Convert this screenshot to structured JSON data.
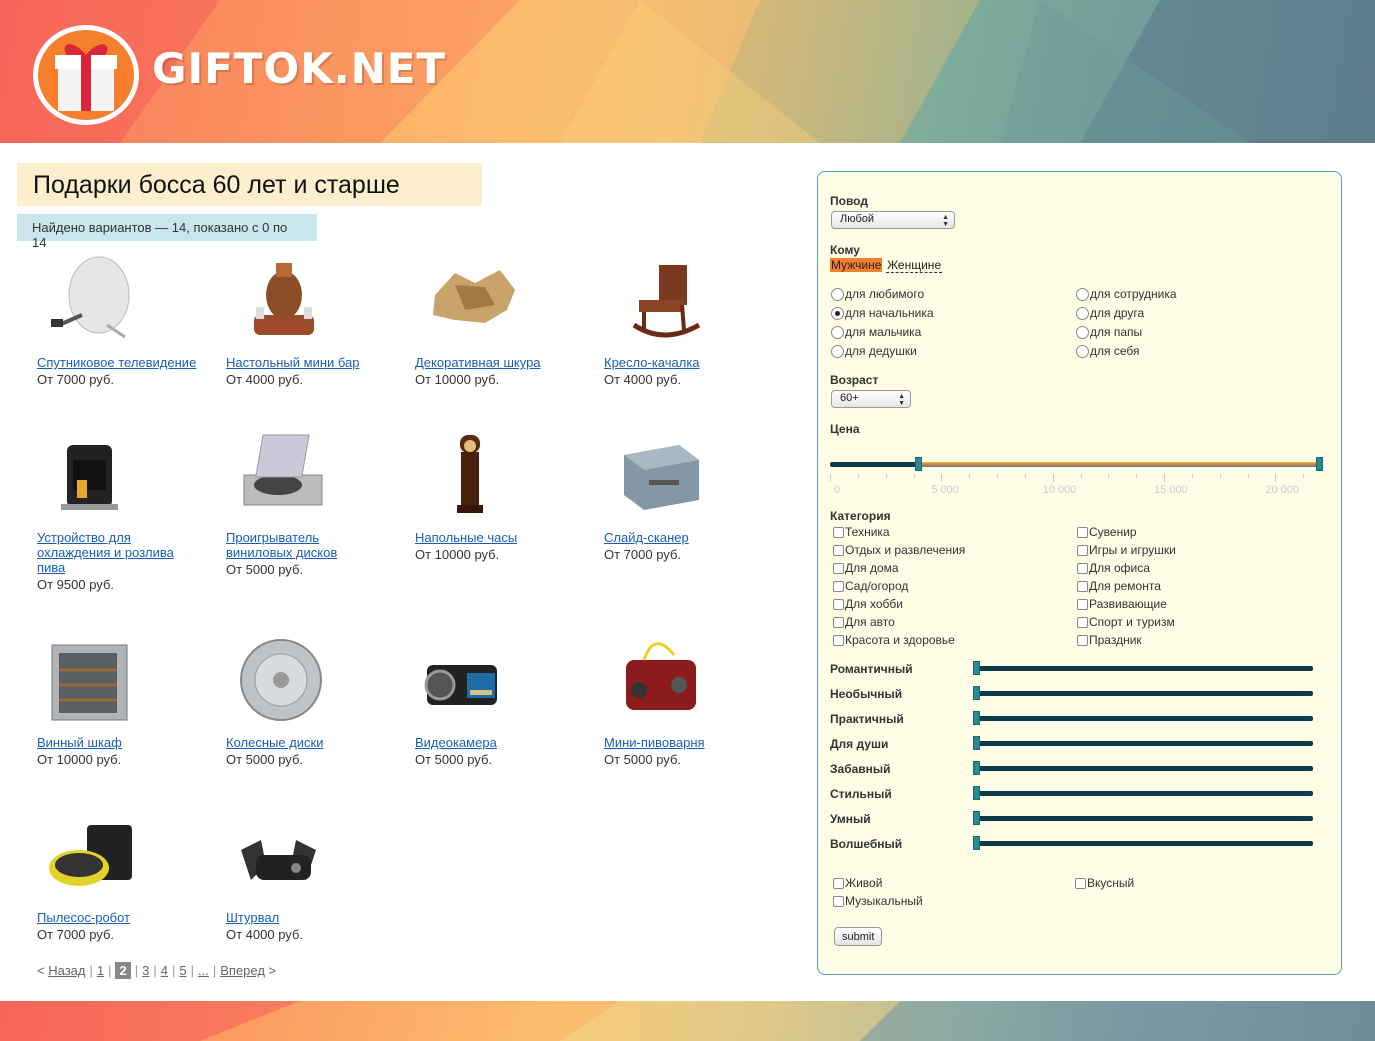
{
  "brand": "GIFTOK.NET",
  "page_title": "Подарки босса 60 лет и старше",
  "found_text": "Найдено вариантов — 14, показано с 0 по 14",
  "products": [
    {
      "name": "Спутниковое телевидение",
      "price": "От 7000 руб."
    },
    {
      "name": "Настольный мини бар",
      "price": "От 4000 руб."
    },
    {
      "name": "Декоративная шкура",
      "price": "От 10000 руб."
    },
    {
      "name": "Кресло-качалка",
      "price": "От 4000 руб."
    },
    {
      "name": "Устройство для охлаждения и розлива пива",
      "price": "От 9500 руб."
    },
    {
      "name": "Проигрыватель виниловых дисков",
      "price": "От 5000 руб."
    },
    {
      "name": "Напольные часы",
      "price": "От 10000 руб."
    },
    {
      "name": "Слайд-сканер",
      "price": "От 7000 руб."
    },
    {
      "name": "Винный шкаф",
      "price": "От 10000 руб."
    },
    {
      "name": "Колесные диски",
      "price": "От 5000 руб."
    },
    {
      "name": "Видеокамера",
      "price": "От 5000 руб."
    },
    {
      "name": "Мини-пивоварня",
      "price": "От 5000 руб."
    },
    {
      "name": "Пылесос-робот",
      "price": "От 7000 руб."
    },
    {
      "name": "Штурвал",
      "price": "От 4000 руб."
    }
  ],
  "pager": {
    "prev": "Назад",
    "next": "Вперед",
    "pages": [
      "1",
      "2",
      "3",
      "4",
      "5",
      "..."
    ],
    "current": "2"
  },
  "filters": {
    "occasion_label": "Повод",
    "occasion_value": "Любой",
    "whom_label": "Кому",
    "gender_tabs": [
      "Мужчине",
      "Женщине"
    ],
    "gender_selected": "Мужчине",
    "recipients": [
      {
        "label": "для любимого",
        "checked": false
      },
      {
        "label": "для сотрудника",
        "checked": false
      },
      {
        "label": "для начальника",
        "checked": true
      },
      {
        "label": "для друга",
        "checked": false
      },
      {
        "label": "для мальчика",
        "checked": false
      },
      {
        "label": "для папы",
        "checked": false
      },
      {
        "label": "для дедушки",
        "checked": false
      },
      {
        "label": "для себя",
        "checked": false
      }
    ],
    "age_label": "Возраст",
    "age_value": "60+",
    "price_label": "Цена",
    "price_range": {
      "min": 4000,
      "max": 22000,
      "scale_max": 22000
    },
    "price_ticks": [
      "0",
      "5 000",
      "10 000",
      "15 000",
      "20 000"
    ],
    "category_label": "Категория",
    "categories": [
      "Техника",
      "Сувенир",
      "Отдых и развлечения",
      "Игры и игрушки",
      "Для дома",
      "Для офиса",
      "Сад/огород",
      "Для ремонта",
      "Для хобби",
      "Развивающие",
      "Для авто",
      "Спорт и туризм",
      "Красота и здоровье",
      "Праздник"
    ],
    "traits": [
      "Романтичный",
      "Необычный",
      "Практичный",
      "Для души",
      "Забавный",
      "Стильный",
      "Умный",
      "Волшебный"
    ],
    "extras": [
      "Живой",
      "Вкусный",
      "Музыкальный"
    ],
    "submit": "submit"
  },
  "colors": {
    "accent": "#f57f2c",
    "panel_bg": "#fefde6",
    "panel_border": "#56a0c6",
    "link": "#1a5fb4",
    "slider": "#0e3b4b"
  }
}
